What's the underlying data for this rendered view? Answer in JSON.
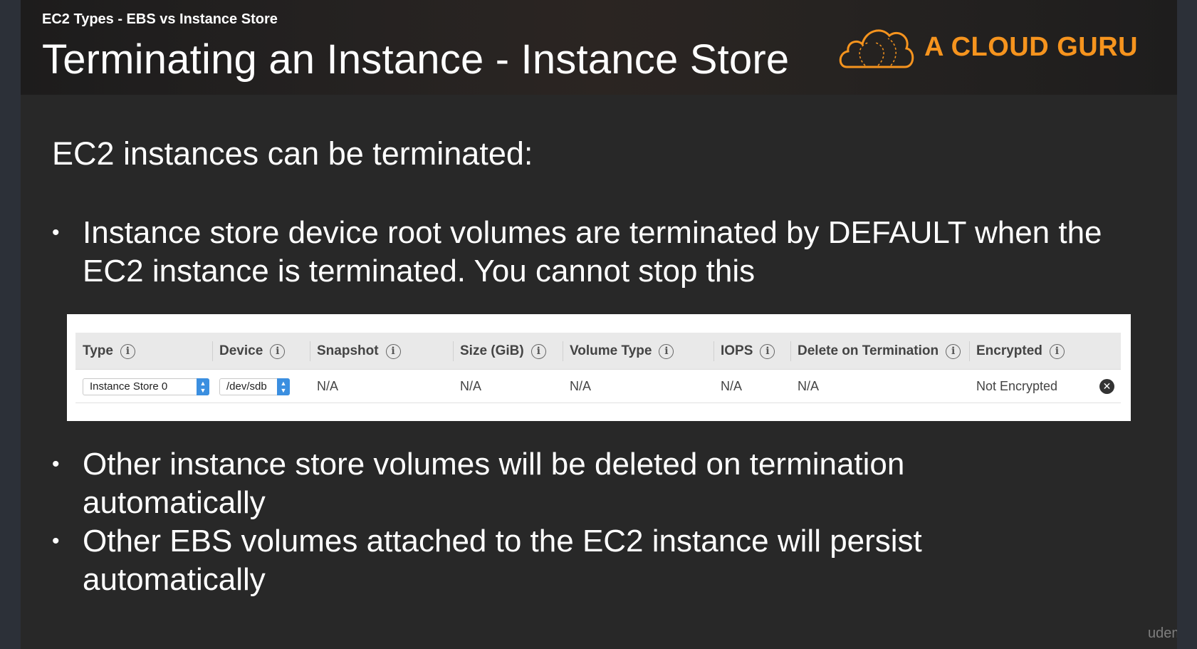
{
  "header": {
    "subtitle": "EC2 Types - EBS vs Instance Store",
    "title": "Terminating an Instance - Instance Store",
    "logo_text": "A CLOUD GURU",
    "brand_color": "#f6941e"
  },
  "intro": "EC2 instances can be terminated:",
  "bullets": [
    {
      "lines": [
        "Instance store device root volumes are terminated by DEFAULT when the",
        "EC2 instance is terminated. You cannot stop this"
      ]
    },
    {
      "lines": [
        "Other instance store volumes will be deleted on termination",
        "automatically"
      ]
    },
    {
      "lines": [
        "Other EBS volumes attached to the EC2 instance will persist",
        "automatically"
      ]
    }
  ],
  "table": {
    "columns": [
      "Type",
      "Device",
      "Snapshot",
      "Size (GiB)",
      "Volume Type",
      "IOPS",
      "Delete on Termination",
      "Encrypted"
    ],
    "row": {
      "type": "Instance Store 0",
      "device": "/dev/sdb",
      "snapshot": "N/A",
      "size": "N/A",
      "volume_type": "N/A",
      "iops": "N/A",
      "delete_on_termination": "N/A",
      "encrypted": "Not Encrypted"
    },
    "info_glyph": "i",
    "remove_glyph": "✕"
  },
  "watermark": "udemy"
}
